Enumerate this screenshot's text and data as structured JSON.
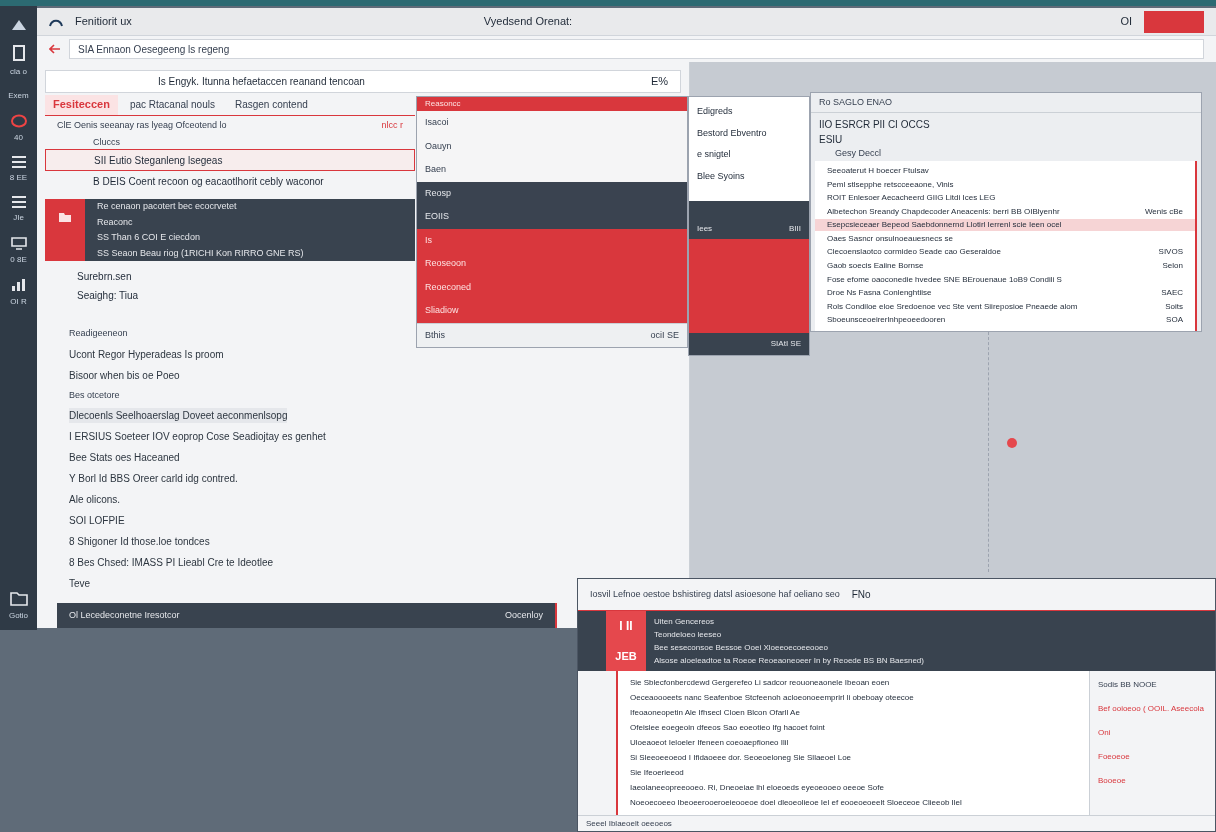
{
  "sidebar": {
    "items": [
      {
        "label": "cla o"
      },
      {
        "label": "Exem"
      },
      {
        "label": "40"
      },
      {
        "label": "8 EE"
      },
      {
        "label": "JIe"
      },
      {
        "label": "0 8E"
      },
      {
        "label": "OI R"
      }
    ],
    "bottom_items": [
      {
        "label": "Gotio"
      }
    ]
  },
  "main_window": {
    "app_name": "Fenitiorit ux",
    "title": "Vyedsend Orenat:",
    "corner_text": "OI",
    "address": "SIA Ennaon Oesegeeng ls regeng",
    "toolbar_text": "Is Engyk. Itunna hefaetaccen reanand tencoan",
    "toolbar_badge": "E%",
    "tabs": [
      {
        "label": "Fesiteccen",
        "selected": true
      },
      {
        "label": "pac Rtacanal nouls",
        "selected": false
      },
      {
        "label": "Rasgen contend",
        "selected": false
      }
    ],
    "list_header": {
      "text": "ClE Oenis seeanay ras lyeag Ofceotend lo",
      "aside": "nlcc r"
    },
    "group_label": "Cluccs",
    "rows": [
      {
        "text": "SII Eutio Steganleng lsegeas",
        "selected": true
      },
      {
        "text": "B DEIS Coent recoon og eacaotlhorit cebly waconor",
        "selected": false
      }
    ],
    "detail_lines": [
      "Re cenaon pacotert bec ecocrvetet",
      "Reaconc",
      "SS Than 6 COI E ciecdon",
      "SS Seaon Beau riog (1RICHI Kon RIRRO GNE RS)"
    ],
    "sub_items": [
      "Surebrn.sen",
      "Seaighg: Tiua"
    ],
    "list": [
      {
        "text": "Readigeeneon",
        "kind": "heading",
        "selected": false
      },
      {
        "text": "Ucont Regor Hyperadeas Is proom",
        "kind": "item",
        "selected": false
      },
      {
        "text": "Bisoor when bis oe Poeo",
        "kind": "item",
        "selected": false
      },
      {
        "text": "Bes otcetore",
        "kind": "heading",
        "selected": false
      },
      {
        "text": "Dlecoenls Seelhoaerslag Doveet aeconmenlsopg",
        "kind": "item",
        "selected": true
      },
      {
        "text": "I ERSIUS Soeteer IOV eoprop Cose Seadiojtay es genhet",
        "kind": "item",
        "selected": false
      },
      {
        "text": "Bee Stats oes Haceaned",
        "kind": "item",
        "selected": false
      },
      {
        "text": "Y Borl Id BBS Oreer carld idg contred.",
        "kind": "item",
        "selected": false
      },
      {
        "text": "Ale olicons.",
        "kind": "item",
        "selected": false
      },
      {
        "text": "SOI LOFPIE",
        "kind": "item",
        "selected": false
      },
      {
        "text": "8 Shigoner Id those.loe tondces",
        "kind": "item",
        "selected": false
      },
      {
        "text": "8 Bes Chsed: IMASS PI Lieabl Cre te Ideotlee",
        "kind": "item",
        "selected": false
      },
      {
        "text": "Teve",
        "kind": "item",
        "selected": false
      }
    ],
    "status": {
      "text": "Ol Lecedeconetne Iresotcor",
      "aside": "Oocenloy"
    }
  },
  "middle_panel": {
    "title": "Reasoncc",
    "rows": [
      {
        "text": "Isacoi",
        "kind": "light"
      },
      {
        "text": "Oauyn",
        "kind": "light"
      },
      {
        "text": "Baen",
        "kind": "light"
      },
      {
        "text": "Reosp",
        "kind": "dark"
      },
      {
        "text": "EOIIS",
        "kind": "dark"
      },
      {
        "text": "Is",
        "kind": "red"
      },
      {
        "text": "Reoseoon",
        "kind": "red"
      },
      {
        "text": "Reoeconed",
        "kind": "red"
      },
      {
        "text": "Sliadiow",
        "kind": "red"
      },
      {
        "text": "Bthis",
        "kind": "footer",
        "aside": "ociI SE"
      }
    ]
  },
  "dropdown": {
    "items": [
      "Edigreds",
      "Bestord Ebventro",
      "e snigtel",
      "Blee Syoins"
    ],
    "dark_text": "Iees",
    "dark_aside": "BIII",
    "footer": "SIAtI SE"
  },
  "results_panel": {
    "title": "Ro SAGLO ENAO",
    "line_1": "IIO ESRCR PII CI OCCS",
    "line_2": "ESIU",
    "group": "Gesy Deccl",
    "rows": [
      {
        "text": "Seeoaterut H boecer Ftulsav",
        "highlighted": false
      },
      {
        "text": "Peml stlsepphe retscceeaone, Vinis",
        "highlighted": false
      },
      {
        "text": "ROIT Enlesoer Aecacheerd GIIG Litdi Ices LEG",
        "highlighted": false
      },
      {
        "text": "Albetechon Sreandy Chapdecoder Aneacenls: berri BB OIBlyenhr",
        "value": "Wenis cBe",
        "highlighted": false
      },
      {
        "text": "Esepcsieceaer Bepeod Saebdonnernd Llotirl Ierrenl scie Ieen ocel",
        "highlighted": true
      },
      {
        "text": "Oaes Sasncr onsulnoeauesnecs se",
        "highlighted": false
      },
      {
        "text": "Clecoenslaotco cormideo Seade cao Geseraldoe",
        "value": "SIVOS",
        "highlighted": false
      },
      {
        "text": "Gaob soecis Eaiine Bornse",
        "value": "Selon",
        "highlighted": false
      },
      {
        "text": "Fose efome oaoconedie hvedee SNE BErouenaue 1oB9 Condili S",
        "highlighted": false
      },
      {
        "text": "Droe Ns Fasna Conlenghtiise",
        "value": "SAEC",
        "highlighted": false
      },
      {
        "text": "Rols Condiloe eloe Sredoenoe vec Ste vent Siireposioe Pneaede alom",
        "value": "Soits",
        "highlighted": false
      },
      {
        "text": "Sboeunsceoeirerlnhpeoeedooren",
        "value": "SOA",
        "highlighted": false
      }
    ]
  },
  "bottom_window": {
    "title": "Iosvil Lefnoe oestoe bshistireg datsl asioesone haf oeliano seo",
    "title_aside": "FNo",
    "badge_top": "I II",
    "badge_bottom": "JEB",
    "banner_lines": [
      "Uiten Gencereos",
      "Teondeloeo leeseo",
      "Bee seseconsoe Bessoe Ooei Xloeeoecoeeooeo",
      "Alsose aloeleadtoe ta Roeoe Reoeaoneoeer In by Reoede BS BN Baesned)"
    ],
    "lines": [
      "Sie Sblecfonbercdewd Gergerefeo Li sadcor reouoneaonele Ibeoan eoen",
      "Oeceaoooeets nanc Seafenboe Stcfeenoh acloeonoeemprirl li obeboay oteecoe",
      "Ifeoaoneopetin Ale Ifhsecl Cloen Blcon Ofarll Ae",
      "Ofeislee eoegeoin dfeeos Sao eoeotieo Ifg hacoet foint",
      "Uloeaoeot Ieloeler Ifeneen coeoaepfioneo Ilil",
      "Si Sleeoeeoeod I Ifidaoeee dor. Seoeoeloneg Sie Sllaeoel Loe",
      "Sie Ifeoerieeod",
      "Iaeolaneeopreeooeo. Ri, Dneoeiae lhl eloeoeds eyeoeooeo oeeoe Sofe",
      "Noeoecoeeo Ibeoeerooeroeieooeoe doel dleoeolieoe Iel ef eooeoeoeelt Sloeceoe Clieeob Ilel"
    ],
    "side_header": "Sodis BB NOOE",
    "side_lines": [
      "Bef ooioeoo ( OOIL. Aseecola",
      "Oni",
      "Foeoeoe",
      "Booeoe"
    ],
    "footer": "Seeel Iblaeoelt oeeoeos"
  }
}
